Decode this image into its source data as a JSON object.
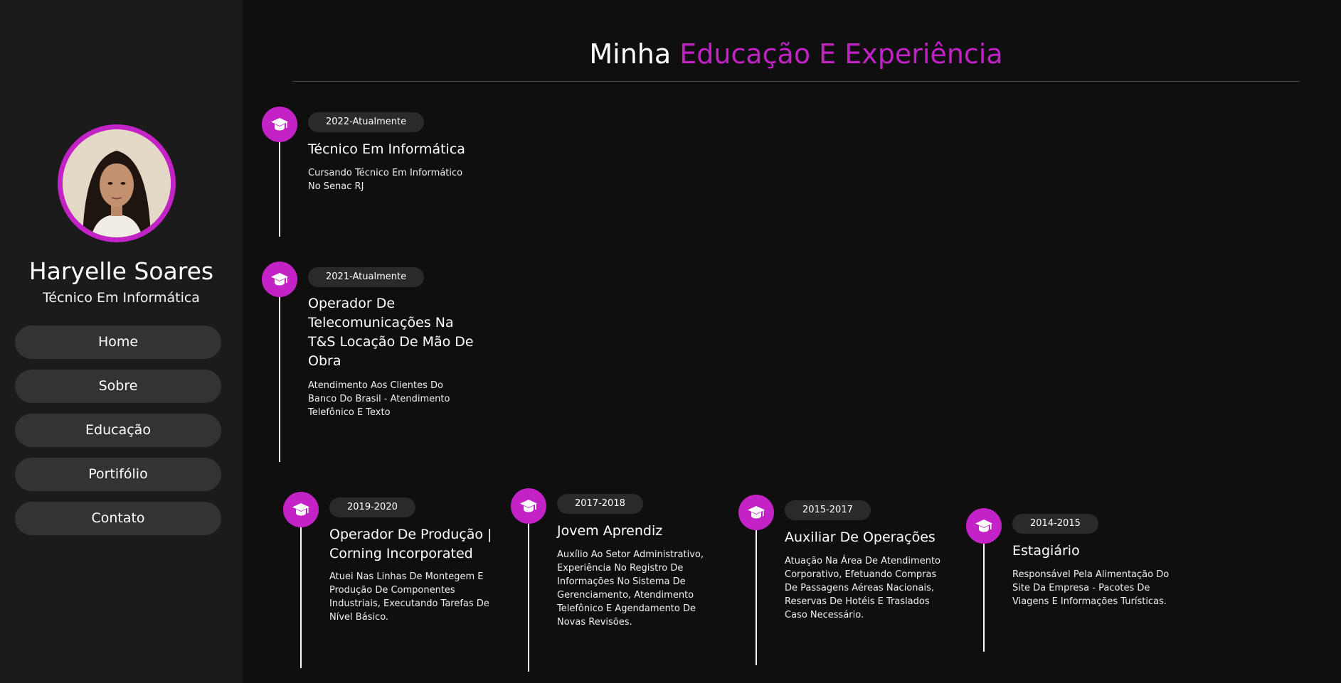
{
  "sidebar": {
    "name": "Haryelle Soares",
    "role": "Técnico Em Informática",
    "nav": [
      "Home",
      "Sobre",
      "Educação",
      "Portifólio",
      "Contato"
    ]
  },
  "main": {
    "title_prefix": "Minha",
    "title_accent": "Educação E Experiência",
    "timeline": [
      {
        "date": "2022-Atualmente",
        "title": "Técnico Em Informática",
        "desc": "Cursando Técnico Em Informático No Senac RJ"
      },
      {
        "date": "2021-Atualmente",
        "title": "Operador De Telecomunicações Na T&S Locação De Mão De Obra",
        "desc": "Atendimento Aos Clientes Do Banco Do Brasil - Atendimento Telefônico E Texto"
      },
      {
        "date": "2019-2020",
        "title": "Operador De Produção | Corning Incorporated",
        "desc": "Atuei Nas Linhas De Montegem E Produção De Componentes Industriais, Executando Tarefas De Nível Básico."
      },
      {
        "date": "2017-2018",
        "title": "Jovem Aprendiz",
        "desc": "Auxílio Ao Setor Administrativo, Experiência No Registro De Informações No Sistema De Gerenciamento, Atendimento Telefônico E Agendamento De Novas Revisões."
      },
      {
        "date": "2015-2017",
        "title": "Auxiliar De Operações",
        "desc": "Atuação Na Área De Atendimento Corporativo, Efetuando Compras De Passagens Aéreas Nacionais, Reservas De Hotéis E Traslados Caso Necessário."
      },
      {
        "date": "2014-2015",
        "title": "Estagiário",
        "desc": "Responsável Pela Alimentação Do Site Da Empresa - Pacotes De Viagens E Informações Turísticas."
      }
    ]
  },
  "colors": {
    "accent": "#c322c6",
    "background": "#0f0f10",
    "sidebar": "#1b1b1c",
    "button": "#333334"
  },
  "icons": {
    "timeline_item": "graduation-cap-icon"
  }
}
